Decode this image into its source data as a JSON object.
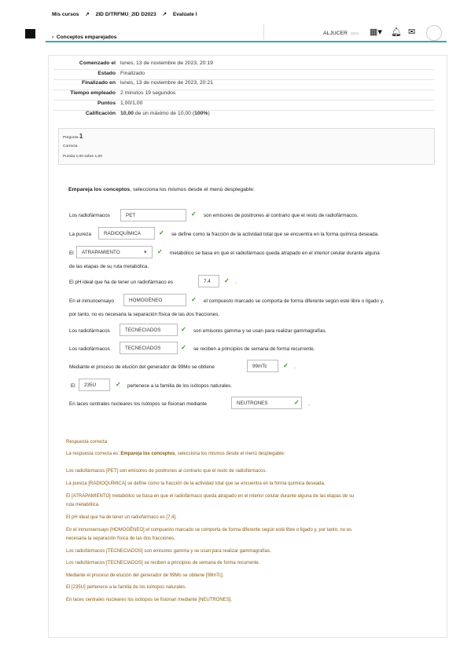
{
  "breadcrumb": {
    "items": [
      "Mis cursos",
      "2ID D/TRFMU_2ID D2023",
      "Evalúate I"
    ],
    "current": "Conceptos emparejados"
  },
  "user": {
    "name": "ALJUCER",
    "small": "2023"
  },
  "summary": [
    {
      "k": "Comenzado el",
      "v": "lunes, 13 de noviembre de 2023, 20:19"
    },
    {
      "k": "Estado",
      "v": "Finalizado"
    },
    {
      "k": "Finalizado en",
      "v": "lunes, 13 de noviembre de 2023, 20:21"
    },
    {
      "k": "Tiempo empleado",
      "v": "2 minutos 19 segundos"
    },
    {
      "k": "Puntos",
      "v": "1,00/1,00"
    }
  ],
  "grade": {
    "label": "Calificación",
    "bold_value": "10,00",
    "mid": " de un máximo de 10,00 (",
    "pct": "100%",
    "end": ")"
  },
  "question": {
    "label": "Pregunta",
    "number": "1",
    "state": "Correcta",
    "points": "Puntúa 1,00 sobre 1,00"
  },
  "intro": {
    "bold": "Empareja los conceptos",
    "rest": ", selecciona los mismos desde el menú desplegable:"
  },
  "items": [
    {
      "before": "Los radiofármacos",
      "answer": "PET",
      "after": "son emisores de positrones al contrario que el resto de radiofármacos."
    },
    {
      "before": "La pureza",
      "answer": "RADIOQUÍMICA",
      "after": "se define como la fracción de la actividad total que se encuentra en la forma química deseada."
    },
    {
      "before": "El",
      "answer": "ATRAPAMIENTO",
      "after": "metabólico se basa en que el radiofármaco queda atrapado en el interior celular durante alguna",
      "after2": "de las etapas de su ruta metabólica."
    },
    {
      "before": "El pH ideal que ha de tener un radiofármaco es",
      "answer": "7.4",
      "after": "."
    },
    {
      "before": "En el inmunoensayo",
      "answer": "HOMOGÉNEO",
      "after": "el compuesto marcado se comporta de forma diferente según esté libre o ligado y,",
      "after2": "por tanto, no es necesaria la separación física de las dos fracciones."
    },
    {
      "before": "Los radiofármacos",
      "answer": "TECNECIADOS",
      "after": "son emisores gamma y se usan para realizar gammagrafías."
    },
    {
      "before": "Los radiofármacos",
      "answer": "TECNECIADOS",
      "after": "se reciben a principios de semana de forma recurrente."
    },
    {
      "before": "Mediante el proceso de elución del generador de 99Mo se obtiene",
      "answer": "99mTc",
      "after": "."
    },
    {
      "before": "El",
      "answer": "235U",
      "after": "pertenece a la familia de los isótopos naturales."
    },
    {
      "before": "En laces centrales nucleares los isótopos se fisionan mediante",
      "answer": "NEUTRONES",
      "after": "."
    }
  ],
  "feedback": {
    "status": "Respuesta correcta",
    "intro_pre": "La respuesta correcta es: ",
    "intro_bold": "Empareja los conceptos",
    "intro_post": ", selecciona los mismos desde el menú desplegable:",
    "lines": [
      "Los radiofármacos [PET] son emisores de positrones al contrario que el resto de radiofármacos.",
      "La pureza [RADIOQUÍMICA] se define como la fracción de la actividad total que se encuentra en la forma química deseada.",
      "El [ATRAPAMIENTO] metabólico se basa en que el radiofármaco queda atrapado en el interior celular durante alguna de las etapas de su",
      "ruta metabólica.",
      "El pH ideal que ha de tener un radiofármaco es  [7.4].",
      "En el inmunoensayo [HOMOGÉNEO] el compuesto marcado se comporta de forma diferente según esté libre o ligado y, por tanto, no es",
      "necesaria la separación física de las dos fracciones.",
      "Los radiofármacos [TECNECIADOS] son emisores gamma y se usan para realizar gammagrafías.",
      "Los radiofármacos [TECNECIADOS] se reciben a principios de semana de forma recurrente.",
      "Mediante el proceso de elución del generador de 99Mo se obtiene [99mTc].",
      " El [235U] pertenece a la familia de los isótopos naturales.",
      "En laces centrales nucleares los isótopos se fisionan mediante [NEUTRONES]."
    ]
  },
  "icons": {
    "menu": "menu-icon",
    "grid": "grid-icon",
    "bell": "bell-icon",
    "mail": "mail-icon",
    "check": "check-icon",
    "dropdown": "chevron-down-icon"
  }
}
